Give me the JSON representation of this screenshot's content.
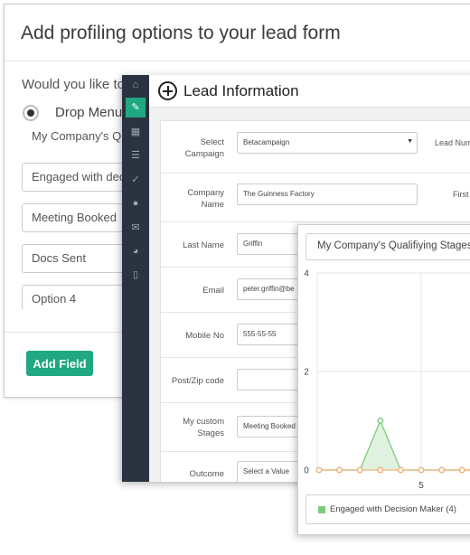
{
  "dialog": {
    "title": "Add profiling options to your lead form",
    "question": "Would you like to",
    "radio_label": "Drop Menu",
    "field_label": "My Company's Qu",
    "options": [
      "Engaged with deci",
      "Meeting Booked",
      "Docs Sent",
      "Option 4"
    ],
    "add_field_label": "Add Field",
    "accent_color": "#1fa882"
  },
  "lead_window": {
    "title": "Lead Information",
    "sidebar_icons": [
      "home-icon",
      "edit-icon",
      "calendar-icon",
      "list-icon",
      "wrench-icon",
      "users-icon",
      "mail-icon",
      "dashboard-icon",
      "book-icon"
    ],
    "fields": {
      "campaign": {
        "label": "Select Campaign",
        "value": "Betacampaign"
      },
      "lead_number": {
        "label": "Lead Num"
      },
      "company": {
        "label": "Company Name",
        "value": "The Guinness Factory"
      },
      "first": {
        "label": "First"
      },
      "last_name": {
        "label": "Last Name",
        "value": "Griffin"
      },
      "email": {
        "label": "Email",
        "value": "peter.griffin@be"
      },
      "mobile": {
        "label": "Mobile No",
        "value": "555-55-55"
      },
      "postcode": {
        "label": "Post/Zip code",
        "value": ""
      },
      "custom_stages": {
        "label": "My custom Stages",
        "value": "Meeting Booked"
      },
      "outcome": {
        "label": "Outcome",
        "value": "Select a Value"
      }
    }
  },
  "chart_window": {
    "header": "My Company's Qualifiying Stages",
    "legend_label": "Engaged with Decision Maker (4)",
    "series_color": "#7ecb7e",
    "baseline_color": "#f0b27a"
  },
  "chart_data": {
    "type": "area",
    "title": "My Company's Qualifiying Stages",
    "x_tick_labels": [
      "5"
    ],
    "y_tick_labels": [
      "0",
      "2",
      "4"
    ],
    "ylim": [
      0,
      4
    ],
    "grid": true,
    "legend_placement": "bottom",
    "series": [
      {
        "name": "Engaged with Decision Maker (4)",
        "values": [
          0,
          0,
          0,
          1,
          0,
          0,
          0,
          0,
          0,
          0
        ]
      }
    ],
    "baseline_values": [
      0,
      0,
      0,
      0,
      0,
      0,
      0,
      0,
      0,
      0
    ]
  }
}
